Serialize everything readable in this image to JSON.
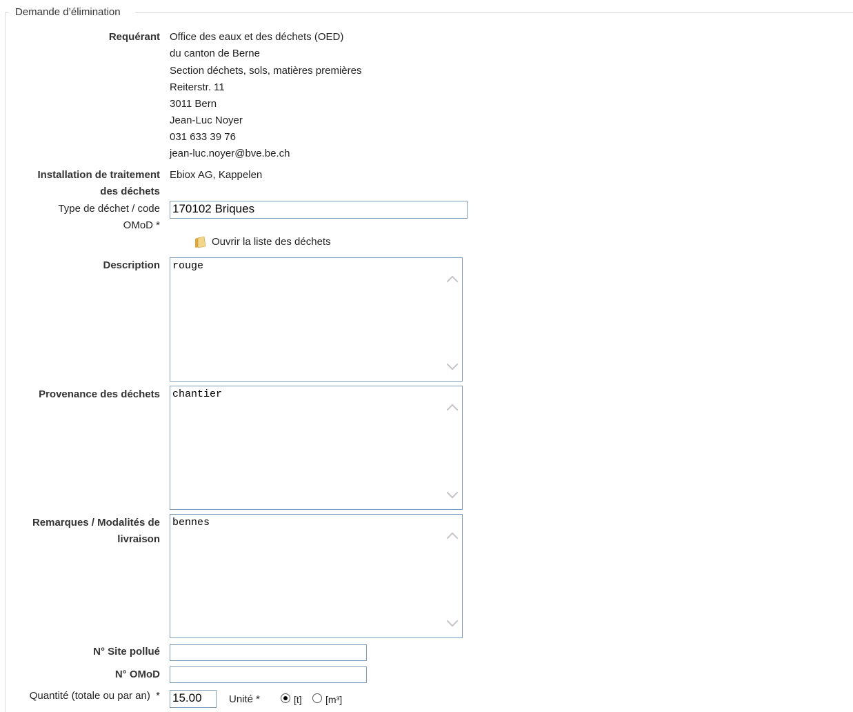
{
  "fieldset": {
    "legend": "Demande d’élimination"
  },
  "requester": {
    "label": "Requérant",
    "lines": [
      "Office des eaux et des déchets (OED)",
      "du canton de Berne",
      "Section déchets, sols, matières premières",
      "Reiterstr. 11",
      "3011 Bern",
      "Jean-Luc Noyer",
      "031 633 39 76",
      "jean-luc.noyer@bve.be.ch"
    ]
  },
  "facility": {
    "label_line1": "Installation de traitement",
    "label_line2": "des déchets",
    "value": "Ebiox AG, Kappelen"
  },
  "waste_type": {
    "label_line1": "Type de déchet / code",
    "label_line2": "OMoD *",
    "value": "170102  Briques"
  },
  "waste_list_link": {
    "label": "Ouvrir la liste des déchets",
    "icon": "folder-icon"
  },
  "description": {
    "label": "Description",
    "value": "rouge"
  },
  "origin": {
    "label": "Provenance des déchets",
    "value": "chantier"
  },
  "remarks": {
    "label_line1": "Remarques / Modalités de",
    "label_line2": "livraison",
    "value": "bennes"
  },
  "polluted_site": {
    "label": "N° Site pollué",
    "value": ""
  },
  "omod_number": {
    "label": "N° OMoD",
    "value": ""
  },
  "quantity": {
    "label": "Quantité (totale ou par an)  *",
    "value": "15.00"
  },
  "unit": {
    "label": "Unité *",
    "options": [
      {
        "label": "[t]",
        "checked": true
      },
      {
        "label": "[m³]",
        "checked": false
      }
    ]
  }
}
